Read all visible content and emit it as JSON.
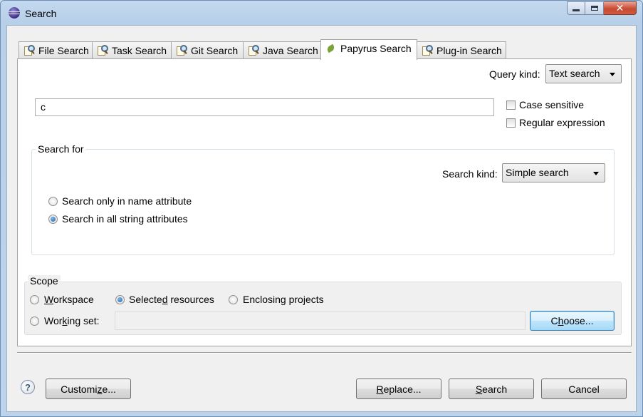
{
  "window": {
    "title": "Search"
  },
  "tabs": [
    {
      "label": "File Search",
      "active": false
    },
    {
      "label": "Task Search",
      "active": false
    },
    {
      "label": "Git Search",
      "active": false
    },
    {
      "label": "Java Search",
      "active": false
    },
    {
      "label": "Papyrus Search",
      "active": true
    },
    {
      "label": "Plug-in Search",
      "active": false
    }
  ],
  "query": {
    "kind_label": "Query kind:",
    "kind_value": "Text search",
    "search_text": "c",
    "case_sensitive_label": "Case sensitive",
    "case_sensitive": false,
    "regex_label": "Regular expression",
    "regex": false
  },
  "search_for": {
    "title": "Search for",
    "kind_label": "Search kind:",
    "kind_value": "Simple search",
    "options": [
      {
        "label": "Search only in name attribute",
        "selected": false
      },
      {
        "label": "Search in all string attributes",
        "selected": true
      }
    ]
  },
  "scope": {
    "title": "Scope",
    "workspace": {
      "pre": "",
      "accel": "W",
      "post": "orkspace",
      "selected": false
    },
    "selected_resources": {
      "pre": "Selecte",
      "accel": "d",
      "post": " resources",
      "selected": true
    },
    "enclosing_projects": {
      "pre": "Enclosing pro",
      "accel": "j",
      "post": "ects",
      "selected": false
    },
    "working_set": {
      "pre": "Wor",
      "accel": "k",
      "post": "ing set:",
      "selected": false,
      "value": ""
    },
    "choose_button": {
      "pre": "C",
      "accel": "h",
      "post": "oose..."
    }
  },
  "footer": {
    "customize": {
      "pre": "Customi",
      "accel": "z",
      "post": "e..."
    },
    "replace": {
      "pre": "",
      "accel": "R",
      "post": "eplace..."
    },
    "search": {
      "pre": "",
      "accel": "S",
      "post": "earch"
    },
    "cancel": "Cancel"
  },
  "icons": {
    "help": "help-icon",
    "app": "eclipse-icon"
  }
}
